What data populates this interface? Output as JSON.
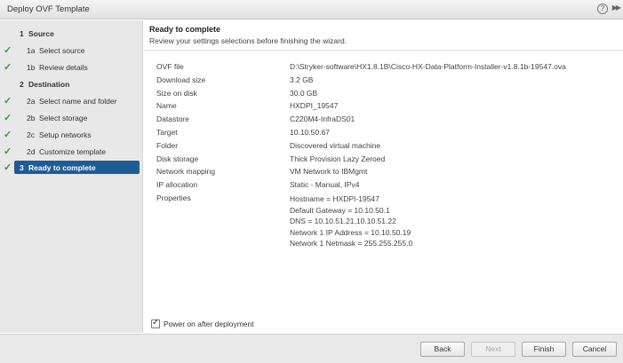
{
  "window": {
    "title": "Deploy OVF Template"
  },
  "sidebar": {
    "steps": [
      {
        "num": "1",
        "label": "Source"
      },
      {
        "num": "1a",
        "label": "Select source"
      },
      {
        "num": "1b",
        "label": "Review details"
      },
      {
        "num": "2",
        "label": "Destination"
      },
      {
        "num": "2a",
        "label": "Select name and folder"
      },
      {
        "num": "2b",
        "label": "Select storage"
      },
      {
        "num": "2c",
        "label": "Setup networks"
      },
      {
        "num": "2d",
        "label": "Customize template"
      },
      {
        "num": "3",
        "label": "Ready to complete"
      }
    ]
  },
  "main": {
    "title": "Ready to complete",
    "subtitle": "Review your settings selections before finishing the wizard.",
    "summary": [
      {
        "key": "OVF file",
        "value": "D:\\Stryker-software\\HX1.8.1B\\Cisco-HX-Data-Platform-Installer-v1.8.1b-19547.ova"
      },
      {
        "key": "Download size",
        "value": "3.2 GB"
      },
      {
        "key": "Size on disk",
        "value": "30.0 GB"
      },
      {
        "key": "Name",
        "value": "HXDPI_19547"
      },
      {
        "key": "Datastore",
        "value": "C220M4-InfraDS01"
      },
      {
        "key": "Target",
        "value": "10.10.50.67"
      },
      {
        "key": "Folder",
        "value": "Discovered virtual machine"
      },
      {
        "key": "Disk storage",
        "value": "Thick Provision Lazy Zeroed"
      },
      {
        "key": "Network mapping",
        "value": "VM Network to IBMgmt"
      },
      {
        "key": "IP allocation",
        "value": "Static - Manual, IPv4"
      }
    ],
    "properties": {
      "key": "Properties",
      "lines": [
        "Hostname = HXDPI-19547",
        "Default Gateway = 10.10.50.1",
        "DNS = 10.10.51.21,10.10.51.22",
        "Network 1 IP Address = 10.10.50.19",
        "Network 1 Netmask = 255.255.255.0"
      ]
    },
    "power_on_label": "Power on after deployment"
  },
  "footer": {
    "back": "Back",
    "next": "Next",
    "finish": "Finish",
    "cancel": "Cancel"
  }
}
